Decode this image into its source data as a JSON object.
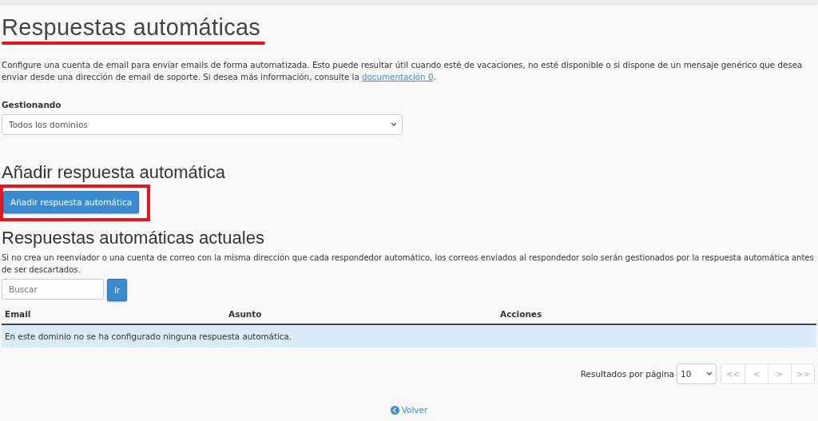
{
  "page_title": "Respuestas automáticas",
  "intro": {
    "text": "Configure una cuenta de email para enviar emails de forma automatizada. Esto puede resultar útil cuando esté de vacaciones, no esté disponible o si dispone de un mensaje genérico que desea enviar desde una dirección de email de soporte. Si desea más información, consulte la",
    "link": "documentación 0",
    "after": "."
  },
  "managing": {
    "label": "Gestionando",
    "value": "Todos los dominios"
  },
  "add_section": {
    "heading": "Añadir respuesta automática",
    "button": "Añadir respuesta automática"
  },
  "current_section": {
    "heading": "Respuestas automáticas actuales",
    "note": "Si no crea un reenviador o una cuenta de correo con la misma dirección que cada respondedor automático, los correos enviados al respondedor solo serán gestionados por la respuesta automática antes de ser descartados."
  },
  "search": {
    "placeholder": "Buscar",
    "button": "Ir"
  },
  "table": {
    "columns": [
      "Email",
      "Asunto",
      "Acciones"
    ],
    "empty_message": "En este dominio no se ha configurado ninguna respuesta automática."
  },
  "pagination": {
    "label": "Resultados por página",
    "per_page": "10",
    "buttons": [
      {
        "label": "<<",
        "disabled": true
      },
      {
        "label": "<",
        "disabled": true
      },
      {
        "label": ">",
        "disabled": true
      },
      {
        "label": ">>",
        "disabled": true
      }
    ]
  },
  "back_link": "Volver"
}
